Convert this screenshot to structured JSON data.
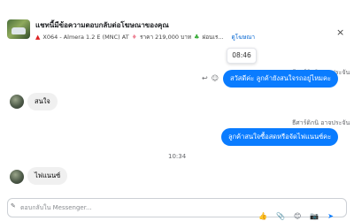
{
  "header": {
    "title": "แชทนี้มีข้อความตอบกลับต่อโฆษณาของคุณ",
    "car_icon": "car-emoji",
    "model": "X064 - Almera 1.2 E (MNC) AT",
    "tag_icon": "tag-emoji",
    "price": "ราคา 219,000 บาท",
    "leaf_icon": "leaf-emoji",
    "extra": "ผ่อนเร...",
    "view_link": "ดูโฆษณา",
    "close_symbol": "×"
  },
  "tooltip": {
    "time": "08:46"
  },
  "messages": [
    {
      "direction": "out",
      "sender": "ธีศาร์ดิกนิ อาจประจัน",
      "text": "สวัสดีค่ะ ลูกค้ายังสนใจรถอยู่ไหมคะ"
    },
    {
      "direction": "in",
      "text": "สนใจ"
    },
    {
      "direction": "out",
      "sender": "ธีศาร์ดิกนิ อาจประจัน",
      "text": "ลูกค้าสนใจซื้อสดหรือจัดไฟแนนซ์คะ"
    },
    {
      "direction": "in",
      "text": "ไฟแนนซ์"
    }
  ],
  "center_time": "10:34",
  "message_actions": {
    "reply_icon": "↩",
    "emoji_icon": "☺"
  },
  "composer": {
    "placeholder": "ตอบกลับใน Messenger...",
    "toolbar_icons": [
      "👍",
      "📎",
      "😊",
      "📷",
      "➤"
    ]
  }
}
